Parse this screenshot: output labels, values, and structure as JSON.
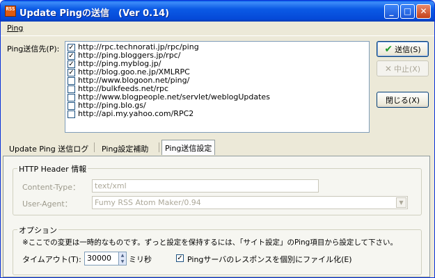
{
  "window": {
    "app_icon": "RSS",
    "title": "Update Pingの送信　(Ver 0.14)",
    "controls": {
      "minimize": "_",
      "maximize": "□",
      "close": "✕"
    }
  },
  "menu": {
    "ping": "Ping"
  },
  "destinations": {
    "label": "Ping送信先(P):",
    "items": [
      {
        "url": "http://rpc.technorati.jp/rpc/ping",
        "checked": true
      },
      {
        "url": "http://ping.bloggers.jp/rpc/",
        "checked": true
      },
      {
        "url": "http://ping.myblog.jp/",
        "checked": true
      },
      {
        "url": "http://blog.goo.ne.jp/XMLRPC",
        "checked": true
      },
      {
        "url": "http://www.blogoon.net/ping/",
        "checked": false
      },
      {
        "url": "http://bulkfeeds.net/rpc",
        "checked": false
      },
      {
        "url": "http://www.blogpeople.net/servlet/weblogUpdates",
        "checked": false
      },
      {
        "url": "http://ping.blo.gs/",
        "checked": false
      },
      {
        "url": "http://api.my.yahoo.com/RPC2",
        "checked": false
      }
    ]
  },
  "buttons": {
    "send": "送信(S)",
    "stop": "中止(X)",
    "close": "閉じる(X)"
  },
  "tabs": [
    {
      "label": "Update Ping 送信ログ",
      "active": false
    },
    {
      "label": "Ping設定補助",
      "active": false
    },
    {
      "label": "Ping送信設定",
      "active": true
    }
  ],
  "http_header": {
    "group_title": "HTTP Header 情報",
    "content_type_label": "Content-Type：",
    "content_type_value": "text/xml",
    "user_agent_label": "User-Agent：",
    "user_agent_value": "Fumy RSS Atom Maker/0.94"
  },
  "options": {
    "group_title": "オプション",
    "note": "※ここでの変更は一時的なものです。ずっと設定を保持するには、「サイト設定」のPing項目から設定して下さい。",
    "timeout_label": "タイムアウト(T):",
    "timeout_value": "30000",
    "timeout_unit": "ミリ秒",
    "save_response_label": "Pingサーバのレスポンスを個別にファイル化(E)",
    "save_response_checked": true
  }
}
